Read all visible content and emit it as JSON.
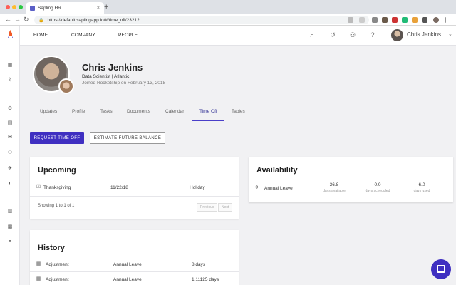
{
  "browser": {
    "tab_title": "Sapling HR",
    "tab_close": "×",
    "new_tab": "+",
    "url": "https://default.saplingapp.io/#/time_off/23212",
    "back": "←",
    "forward": "→",
    "reload": "↻"
  },
  "topnav": {
    "home": "HOME",
    "company": "COMPANY",
    "people": "PEOPLE",
    "user_name": "Chris Jenkins"
  },
  "profile": {
    "name": "Chris Jenkins",
    "role": "Data Scientist | Atlantic",
    "joined": "Joined Rocketship on February 13, 2018"
  },
  "tabs": [
    "Updates",
    "Profile",
    "Tasks",
    "Documents",
    "Calendar",
    "Time Off",
    "Tables"
  ],
  "actions": {
    "request": "REQUEST TIME OFF",
    "estimate": "ESTIMATE FUTURE BALANCE"
  },
  "upcoming": {
    "title": "Upcoming",
    "rows": [
      {
        "name": "Thanksgiving",
        "date": "11/22/18",
        "type": "Holiday"
      }
    ],
    "showing": "Showing 1 to 1 of 1",
    "prev": "Previous",
    "next": "Next"
  },
  "availability": {
    "title": "Availability",
    "policy": "Annual Leave",
    "stats": [
      {
        "value": "36.8",
        "label": "days available"
      },
      {
        "value": "0.0",
        "label": "days scheduled"
      },
      {
        "value": "6.0",
        "label": "days used"
      }
    ]
  },
  "history": {
    "title": "History",
    "rows": [
      {
        "type": "Adjustment",
        "policy": "Annual Leave",
        "amount": "8 days"
      },
      {
        "type": "Adjustment",
        "policy": "Annual Leave",
        "amount": "1.11125 days"
      }
    ]
  },
  "colors": {
    "primary": "#3f2fc1",
    "tab_active": "#3b3b9a"
  }
}
